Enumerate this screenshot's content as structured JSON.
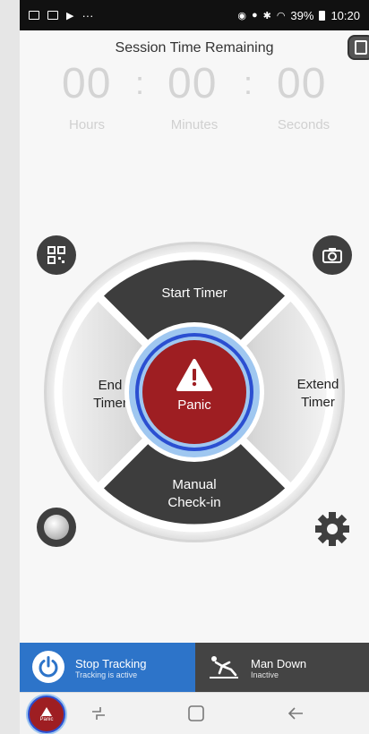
{
  "status_bar": {
    "battery": "39%",
    "time": "10:20"
  },
  "session": {
    "title": "Session Time Remaining",
    "hours": "00",
    "minutes": "00",
    "seconds": "00",
    "separator": ":",
    "hours_label": "Hours",
    "minutes_label": "Minutes",
    "seconds_label": "Seconds"
  },
  "wheel": {
    "start_timer": "Start Timer",
    "end_timer_line1": "End",
    "end_timer_line2": "Timer",
    "extend_timer_line1": "Extend",
    "extend_timer_line2": "Timer",
    "manual_checkin_line1": "Manual",
    "manual_checkin_line2": "Check-in",
    "panic": "Panic"
  },
  "tracking": {
    "title": "Stop Tracking",
    "subtitle": "Tracking is active"
  },
  "mandown": {
    "title": "Man Down",
    "subtitle": "Inactive"
  },
  "nav": {
    "mini_panic_label": "Panic"
  },
  "colors": {
    "panic_red": "#9e1e22",
    "tracking_blue": "#2d74c9",
    "dark_segment": "#3d3d3d"
  },
  "icons": [
    "qr-code-icon",
    "camera-icon",
    "slider-knob-icon",
    "settings-gear-icon",
    "exit-icon",
    "power-icon",
    "man-down-icon",
    "warning-icon",
    "recent-apps-icon",
    "home-icon",
    "back-icon"
  ]
}
